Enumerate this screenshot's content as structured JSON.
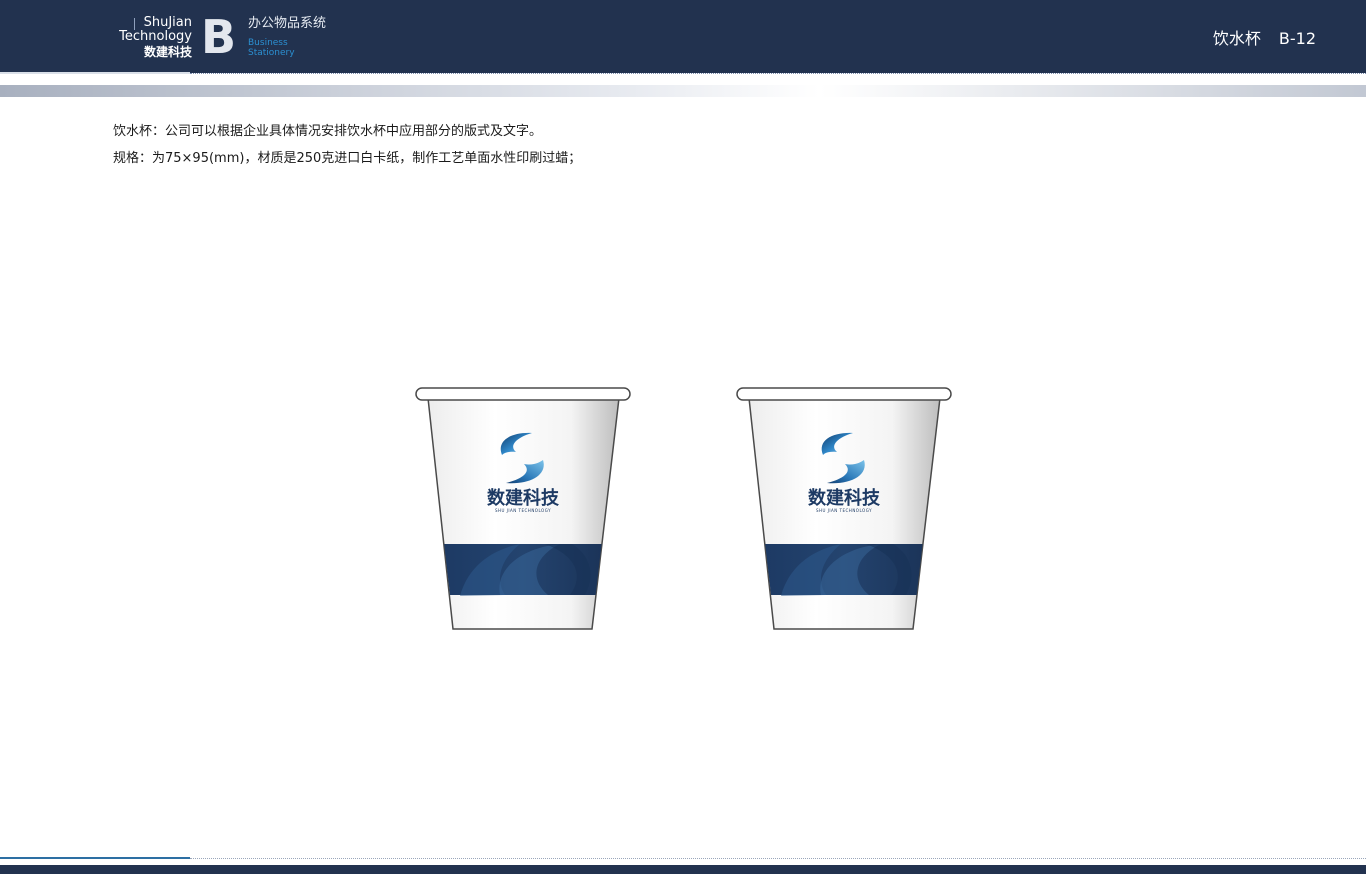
{
  "header": {
    "brand_en_1": "ShuJian",
    "brand_en_2": "Technology",
    "brand_cn": "数建科技",
    "section_letter": "B",
    "system_title": "办公物品系统",
    "system_en_1": "Business",
    "system_en_2": "Stationery",
    "page_name": "饮水杯",
    "page_code": "B-12"
  },
  "content": {
    "line_1": "饮水杯：公司可以根据企业具体情况安排饮水杯中应用部分的版式及文字。",
    "line_2": "规格：为75×95(mm)，材质是250克进口白卡纸，制作工艺单面水性印刷过蜡；"
  },
  "cup": {
    "logo_cn": "数建科技",
    "logo_en": "SHU JIAN TECHNOLOGY"
  },
  "colors": {
    "navy": "#22324f",
    "accent_blue": "#2b8fd1",
    "band_blue": "#1f3f6e"
  }
}
